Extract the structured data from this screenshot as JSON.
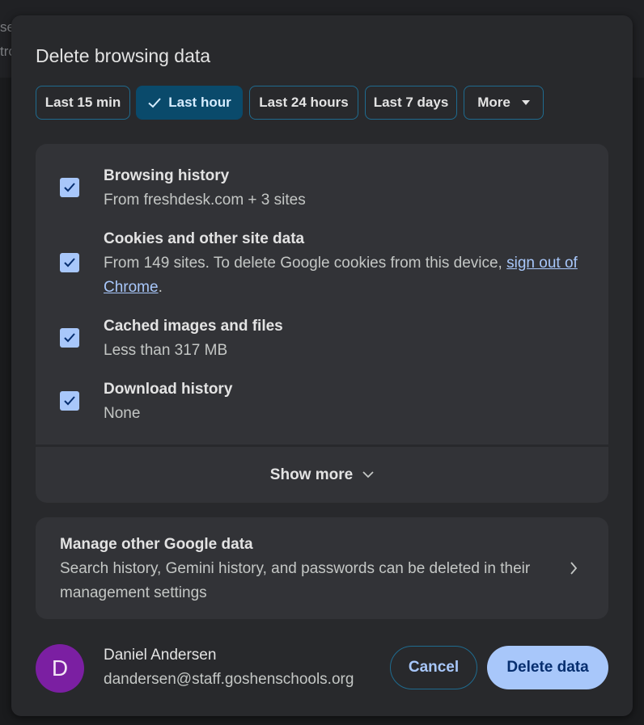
{
  "backdrop": {
    "line1": "se",
    "line2": "tro"
  },
  "dialog": {
    "title": "Delete browsing data",
    "time_ranges": [
      {
        "label": "Last 15 min",
        "selected": false
      },
      {
        "label": "Last hour",
        "selected": true
      },
      {
        "label": "Last 24 hours",
        "selected": false
      },
      {
        "label": "Last 7 days",
        "selected": false
      },
      {
        "label": "More",
        "selected": false
      }
    ],
    "items": [
      {
        "title": "Browsing history",
        "description": "From freshdesk.com + 3 sites",
        "checked": true
      },
      {
        "title": "Cookies and other site data",
        "description_prefix": "From 149 sites. To delete Google cookies from this device, ",
        "link": "sign out of Chrome",
        "description_suffix": ".",
        "checked": true
      },
      {
        "title": "Cached images and files",
        "description": "Less than 317 MB",
        "checked": true
      },
      {
        "title": "Download history",
        "description": "None",
        "checked": true
      }
    ],
    "show_more_label": "Show more",
    "manage": {
      "title": "Manage other Google data",
      "description": "Search history, Gemini history, and passwords can be deleted in their management settings"
    },
    "account": {
      "initial": "D",
      "name": "Daniel Andersen",
      "email": "dandersen@staff.goshenschools.org",
      "avatar_color": "#7b1fa2"
    },
    "buttons": {
      "cancel": "Cancel",
      "delete": "Delete data"
    }
  },
  "colors": {
    "accent": "#a8c7fa",
    "selected_chip": "#0a4a6b",
    "dialog_bg": "#28292c",
    "panel_bg": "#323337"
  }
}
